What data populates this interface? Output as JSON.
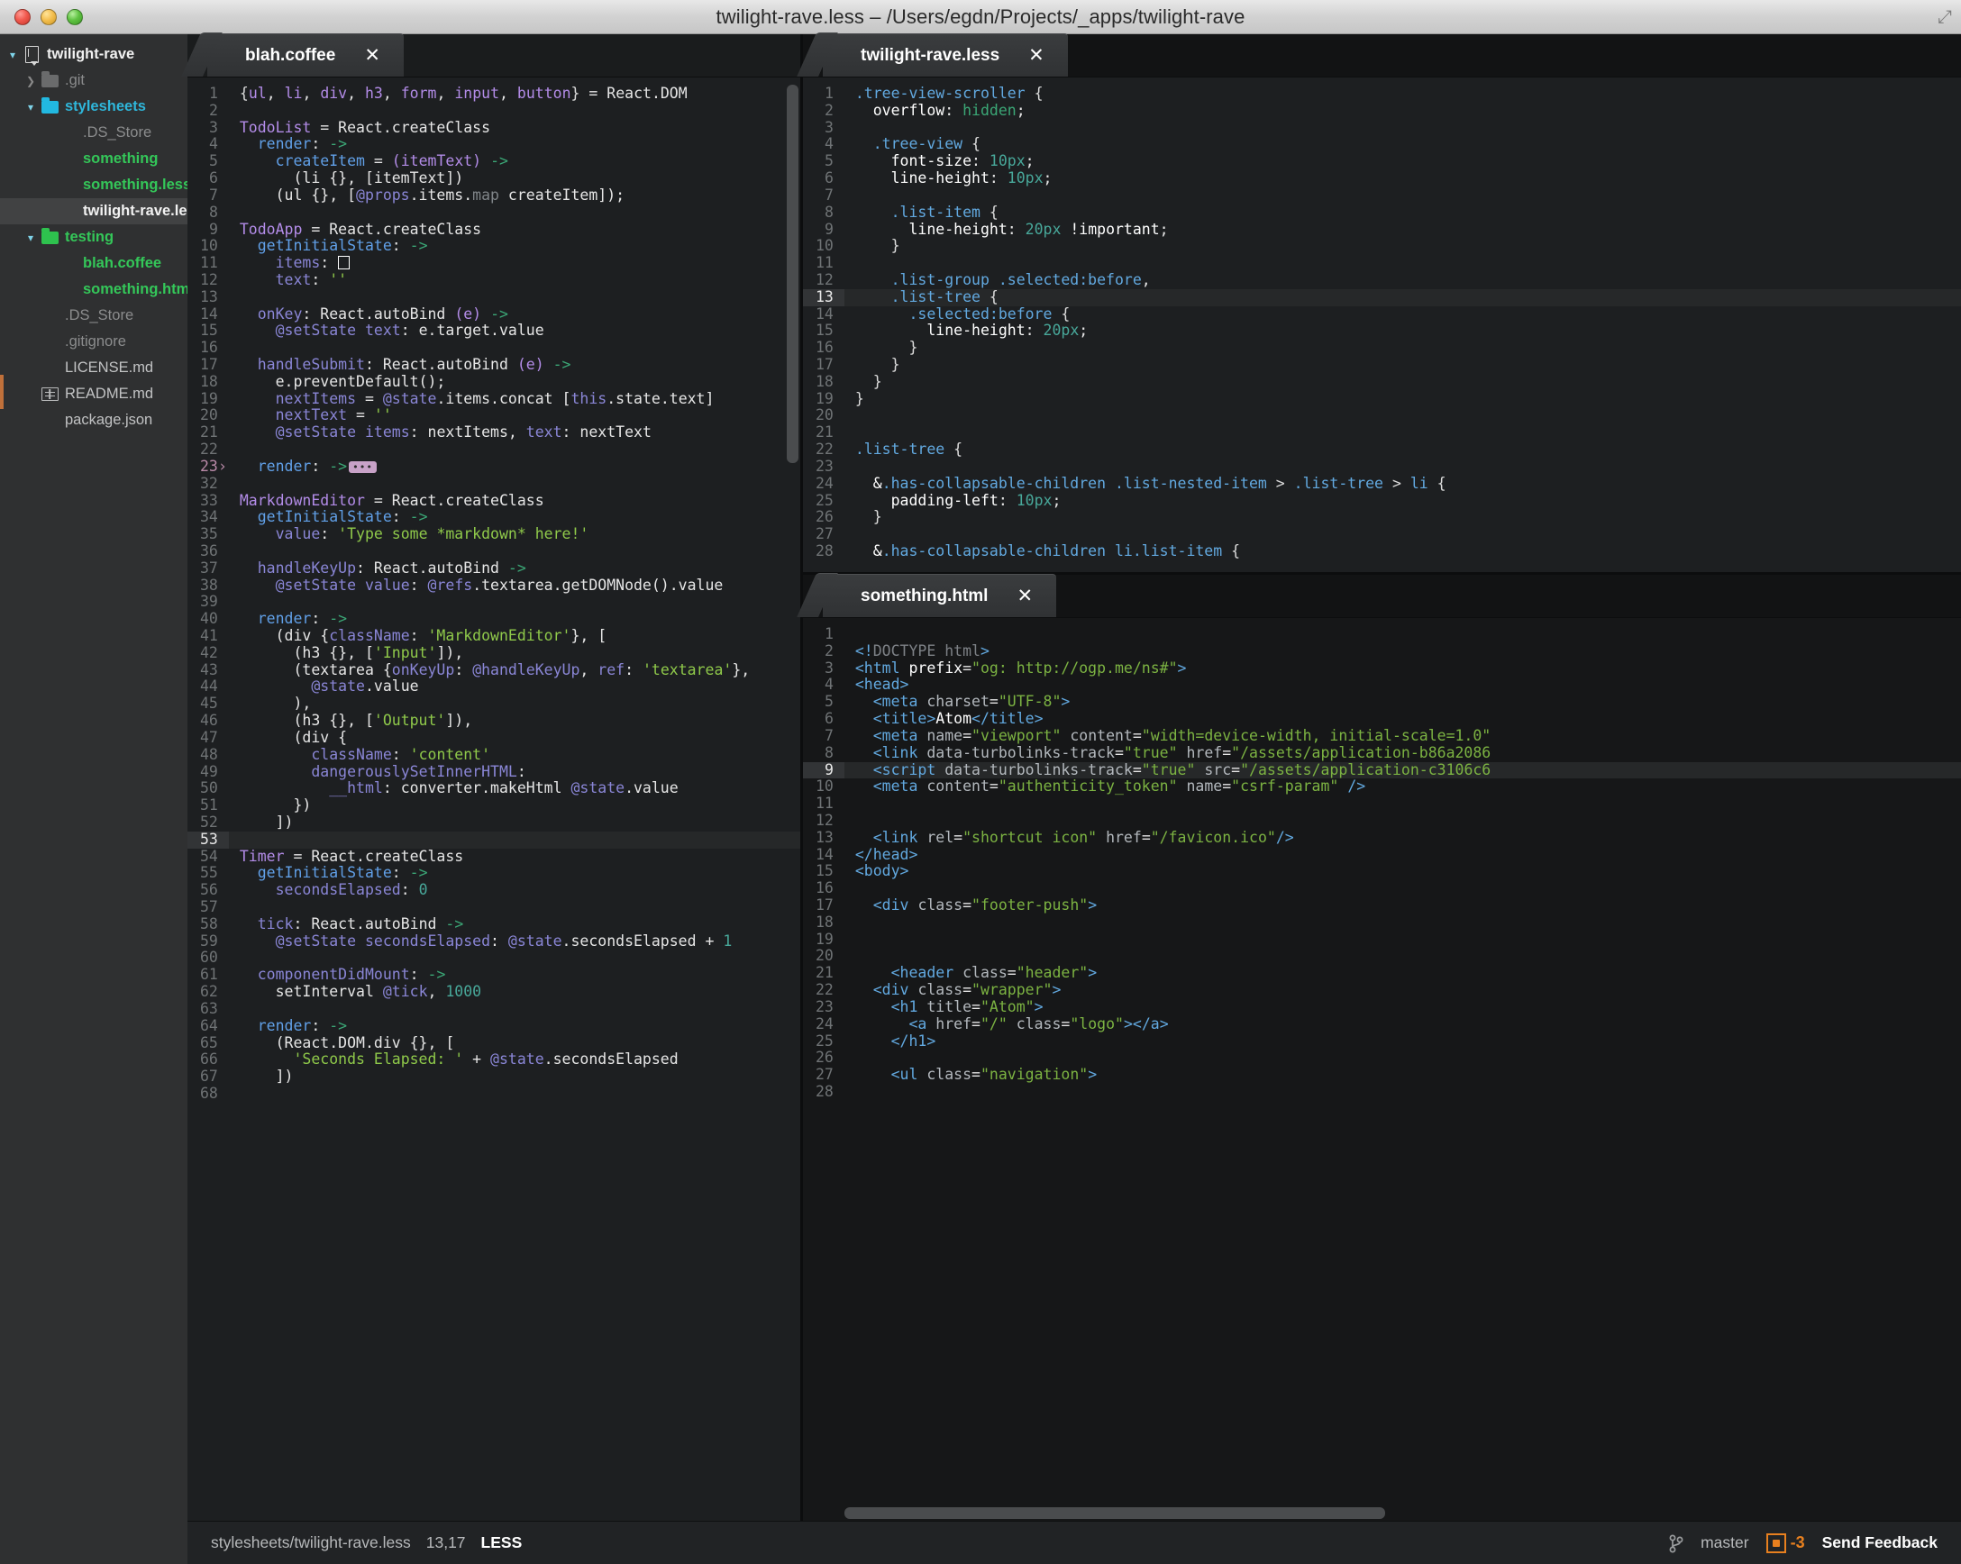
{
  "window": {
    "title": "twilight-rave.less – /Users/egdn/Projects/_apps/twilight-rave",
    "traffic_lights": [
      "close-button",
      "minimize-button",
      "zoom-button"
    ],
    "resize_grip": "⤢"
  },
  "sidebar": {
    "items": [
      {
        "label": "twilight-rave",
        "indent": 0,
        "twisty": "open",
        "icon": "repo-icon",
        "style": "white"
      },
      {
        "label": ".git",
        "indent": 1,
        "twisty": "closed",
        "icon": "folder-grey",
        "style": "dim"
      },
      {
        "label": "stylesheets",
        "indent": 1,
        "twisty": "open",
        "icon": "folder-cyan",
        "style": "cyan"
      },
      {
        "label": ".DS_Store",
        "indent": 2,
        "twisty": "none",
        "icon": "none",
        "style": "dim"
      },
      {
        "label": "something",
        "indent": 2,
        "twisty": "none",
        "icon": "none",
        "style": "green"
      },
      {
        "label": "something.less",
        "indent": 2,
        "twisty": "none",
        "icon": "none",
        "style": "green"
      },
      {
        "label": "twilight-rave.less",
        "indent": 2,
        "twisty": "none",
        "icon": "none",
        "style": "white",
        "selected": true
      },
      {
        "label": "testing",
        "indent": 1,
        "twisty": "open",
        "icon": "folder-green",
        "style": "green"
      },
      {
        "label": "blah.coffee",
        "indent": 2,
        "twisty": "none",
        "icon": "none",
        "style": "green"
      },
      {
        "label": "something.html",
        "indent": 2,
        "twisty": "none",
        "icon": "none",
        "style": "green"
      },
      {
        "label": ".DS_Store",
        "indent": 1,
        "twisty": "none",
        "icon": "none",
        "style": "dim"
      },
      {
        "label": ".gitignore",
        "indent": 1,
        "twisty": "none",
        "icon": "none",
        "style": "dim"
      },
      {
        "label": "LICENSE.md",
        "indent": 1,
        "twisty": "none",
        "icon": "none",
        "style": "mid"
      },
      {
        "label": "README.md",
        "indent": 1,
        "twisty": "none",
        "icon": "book-icon",
        "style": "mid"
      },
      {
        "label": "package.json",
        "indent": 1,
        "twisty": "none",
        "icon": "none",
        "style": "mid"
      }
    ]
  },
  "panes": {
    "left": {
      "tab": {
        "label": "blah.coffee",
        "close": "✕"
      },
      "first_line": 1,
      "lines": [
        {
          "n": "1",
          "html": "<span class='t-brace'>{</span><span class='t-def'>ul</span><span class='t-punct'>, </span><span class='t-def'>li</span><span class='t-punct'>, </span><span class='t-def'>div</span><span class='t-punct'>, </span><span class='t-def'>h3</span><span class='t-punct'>, </span><span class='t-def'>form</span><span class='t-punct'>, </span><span class='t-def'>input</span><span class='t-punct'>, </span><span class='t-def'>button</span><span class='t-brace'>}</span> = React.DOM"
        },
        {
          "n": "2",
          "html": ""
        },
        {
          "n": "3",
          "html": "<span class='t-def'>TodoList</span> = React.createClass"
        },
        {
          "n": "4",
          "html": "  <span class='t-fn'>render</span><span class='t-punct'>:</span> <span class='t-arrow'>-&gt;</span>"
        },
        {
          "n": "5",
          "html": "    <span class='t-fn'>createItem</span> = <span class='t-def'>(itemText)</span> <span class='t-arrow'>-&gt;</span>"
        },
        {
          "n": "6",
          "html": "      (li {}, [itemText])"
        },
        {
          "n": "7",
          "html": "    (ul {}, [<span class='t-prop'>@props</span>.items.<span class='t-grey'>map</span> createItem]);"
        },
        {
          "n": "8",
          "html": ""
        },
        {
          "n": "9",
          "html": "<span class='t-def'>TodoApp</span> = React.createClass"
        },
        {
          "n": "10",
          "html": "  <span class='t-fn'>getInitialState</span><span class='t-punct'>:</span> <span class='t-arrow'>-&gt;</span>"
        },
        {
          "n": "11",
          "html": "    <span class='t-prop'>items</span><span class='t-punct'>:</span> <span class='empty-sq-ph'></span>"
        },
        {
          "n": "12",
          "html": "    <span class='t-prop'>text</span><span class='t-punct'>:</span> <span class='t-str'>''</span>"
        },
        {
          "n": "13",
          "html": ""
        },
        {
          "n": "14",
          "html": "  <span class='t-prop'>onKey</span><span class='t-punct'>:</span> React.autoBind <span class='t-def'>(e)</span> <span class='t-arrow'>-&gt;</span>"
        },
        {
          "n": "15",
          "html": "    <span class='t-prop'>@setState text</span><span class='t-punct'>:</span> e.target.value"
        },
        {
          "n": "16",
          "html": ""
        },
        {
          "n": "17",
          "html": "  <span class='t-prop'>handleSubmit</span><span class='t-punct'>:</span> React.autoBind <span class='t-def'>(e)</span> <span class='t-arrow'>-&gt;</span>"
        },
        {
          "n": "18",
          "html": "    e.preventDefault();"
        },
        {
          "n": "19",
          "html": "    <span class='t-prop'>nextItems</span> = <span class='t-prop'>@state</span>.items.concat [<span class='t-prop'>this</span>.state.text]"
        },
        {
          "n": "20",
          "html": "    <span class='t-prop'>nextText</span> = <span class='t-str'>''</span>"
        },
        {
          "n": "21",
          "html": "    <span class='t-prop'>@setState items</span><span class='t-punct'>:</span> nextItems<span class='t-punct'>,</span> <span class='t-prop'>text</span><span class='t-punct'>:</span> nextText"
        },
        {
          "n": "22",
          "html": ""
        },
        {
          "n": "23",
          "html": "  <span class='t-fn'>render</span><span class='t-punct'>:</span> <span class='t-arrow'>-&gt;</span><span class='fold-ph'></span>",
          "fold": true
        },
        {
          "n": "32",
          "html": ""
        },
        {
          "n": "33",
          "html": "<span class='t-def'>MarkdownEditor</span> = React.createClass"
        },
        {
          "n": "34",
          "html": "  <span class='t-fn'>getInitialState</span><span class='t-punct'>:</span> <span class='t-arrow'>-&gt;</span>"
        },
        {
          "n": "35",
          "html": "    <span class='t-prop'>value</span><span class='t-punct'>:</span> <span class='t-str'>'Type some *markdown* here!'</span>"
        },
        {
          "n": "36",
          "html": ""
        },
        {
          "n": "37",
          "html": "  <span class='t-prop'>handleKeyUp</span><span class='t-punct'>:</span> React.autoBind <span class='t-arrow'>-&gt;</span>"
        },
        {
          "n": "38",
          "html": "    <span class='t-prop'>@setState value</span><span class='t-punct'>:</span> <span class='t-prop'>@refs</span>.textarea.getDOMNode().value"
        },
        {
          "n": "39",
          "html": ""
        },
        {
          "n": "40",
          "html": "  <span class='t-fn'>render</span><span class='t-punct'>:</span> <span class='t-arrow'>-&gt;</span>"
        },
        {
          "n": "41",
          "html": "    (div {<span class='t-prop'>className</span>: <span class='t-str'>'MarkdownEditor'</span>}, ["
        },
        {
          "n": "42",
          "html": "      (h3 {}, [<span class='t-str'>'Input'</span>]),"
        },
        {
          "n": "43",
          "html": "      (textarea {<span class='t-prop'>onKeyUp</span>: <span class='t-prop'>@handleKeyUp</span>, <span class='t-prop'>ref</span>: <span class='t-str'>'textarea'</span>},"
        },
        {
          "n": "44",
          "html": "        <span class='t-prop'>@state</span>.value"
        },
        {
          "n": "45",
          "html": "      ),"
        },
        {
          "n": "46",
          "html": "      (h3 {}, [<span class='t-str'>'Output'</span>]),"
        },
        {
          "n": "47",
          "html": "      (div {"
        },
        {
          "n": "48",
          "html": "        <span class='t-prop'>className</span>: <span class='t-str'>'content'</span>"
        },
        {
          "n": "49",
          "html": "        <span class='t-prop'>dangerouslySetInnerHTML</span>:"
        },
        {
          "n": "50",
          "html": "          <span class='t-prop'>__html</span>: converter.makeHtml <span class='t-prop'>@state</span>.value"
        },
        {
          "n": "51",
          "html": "      })"
        },
        {
          "n": "52",
          "html": "    ])"
        },
        {
          "n": "53",
          "html": "",
          "cursor": true
        },
        {
          "n": "54",
          "html": "<span class='t-def'>Timer</span> = React.createClass"
        },
        {
          "n": "55",
          "html": "  <span class='t-fn'>getInitialState</span><span class='t-punct'>:</span> <span class='t-arrow'>-&gt;</span>"
        },
        {
          "n": "56",
          "html": "    <span class='t-prop'>secondsElapsed</span><span class='t-punct'>:</span> <span class='t-num'>0</span>"
        },
        {
          "n": "57",
          "html": ""
        },
        {
          "n": "58",
          "html": "  <span class='t-prop'>tick</span><span class='t-punct'>:</span> React.autoBind <span class='t-arrow'>-&gt;</span>"
        },
        {
          "n": "59",
          "html": "    <span class='t-prop'>@setState secondsElapsed</span><span class='t-punct'>:</span> <span class='t-prop'>@state</span>.secondsElapsed + <span class='t-num'>1</span>"
        },
        {
          "n": "60",
          "html": ""
        },
        {
          "n": "61",
          "html": "  <span class='t-prop'>componentDidMount</span><span class='t-punct'>:</span> <span class='t-arrow'>-&gt;</span>"
        },
        {
          "n": "62",
          "html": "    setInterval <span class='t-prop'>@tick</span>, <span class='t-num'>1000</span>"
        },
        {
          "n": "63",
          "html": ""
        },
        {
          "n": "64",
          "html": "  <span class='t-fn'>render</span><span class='t-punct'>:</span> <span class='t-arrow'>-&gt;</span>"
        },
        {
          "n": "65",
          "html": "    (React.DOM.div {}, ["
        },
        {
          "n": "66",
          "html": "      <span class='t-str'>'Seconds Elapsed: '</span> + <span class='t-prop'>@state</span>.secondsElapsed"
        },
        {
          "n": "67",
          "html": "    ])"
        },
        {
          "n": "68",
          "html": ""
        }
      ]
    },
    "right_top": {
      "tab": {
        "label": "twilight-rave.less",
        "close": "✕"
      },
      "lines": [
        {
          "n": "1",
          "html": "<span class='t-sel'>.tree-view-scroller</span> <span class='t-brace'>{</span>"
        },
        {
          "n": "2",
          "html": "  <span class='t-plain'>overflow</span><span class='t-punct'>:</span> <span class='t-val'>hidden</span>;"
        },
        {
          "n": "3",
          "html": ""
        },
        {
          "n": "4",
          "html": "  <span class='t-sel'>.tree-view</span> <span class='t-brace'>{</span>"
        },
        {
          "n": "5",
          "html": "    <span class='t-plain'>font-size</span><span class='t-punct'>:</span> <span class='t-num'>10px</span>;"
        },
        {
          "n": "6",
          "html": "    <span class='t-plain'>line-height</span><span class='t-punct'>:</span> <span class='t-num'>10px</span>;"
        },
        {
          "n": "7",
          "html": ""
        },
        {
          "n": "8",
          "html": "    <span class='t-sel'>.list-item</span> <span class='t-brace'>{</span>"
        },
        {
          "n": "9",
          "html": "      <span class='t-plain'>line-height</span><span class='t-punct'>:</span> <span class='t-num'>20px</span> <span class='t-plain'>!important</span>;"
        },
        {
          "n": "10",
          "html": "    <span class='t-brace'>}</span>"
        },
        {
          "n": "11",
          "html": ""
        },
        {
          "n": "12",
          "html": "    <span class='t-sel'>.list-group .selected:before</span>,"
        },
        {
          "n": "13",
          "html": "    <span class='t-sel'>.list-tree</span> <span class='t-brace'>{</span>",
          "cursor": true
        },
        {
          "n": "14",
          "html": "      <span class='t-sel'>.selected:before</span> <span class='t-brace'>{</span>"
        },
        {
          "n": "15",
          "html": "        <span class='t-plain'>line-height</span><span class='t-punct'>:</span> <span class='t-num'>20px</span>;"
        },
        {
          "n": "16",
          "html": "      <span class='t-brace'>}</span>"
        },
        {
          "n": "17",
          "html": "    <span class='t-brace'>}</span>"
        },
        {
          "n": "18",
          "html": "  <span class='t-brace'>}</span>"
        },
        {
          "n": "19",
          "html": "<span class='t-brace'>}</span>"
        },
        {
          "n": "20",
          "html": ""
        },
        {
          "n": "21",
          "html": ""
        },
        {
          "n": "22",
          "html": "<span class='t-sel'>.list-tree</span> <span class='t-brace'>{</span>"
        },
        {
          "n": "23",
          "html": ""
        },
        {
          "n": "24",
          "html": "  <span class='t-amp'>&amp;</span><span class='t-sel'>.has-collapsable-children .list-nested-item</span> <span class='t-brace'>&gt;</span> <span class='t-sel'>.list-tree</span> <span class='t-brace'>&gt;</span> <span class='t-sel'>li</span> <span class='t-brace'>{</span>"
        },
        {
          "n": "25",
          "html": "    <span class='t-plain'>padding-left</span><span class='t-punct'>:</span> <span class='t-num'>10px</span>;"
        },
        {
          "n": "26",
          "html": "  <span class='t-brace'>}</span>"
        },
        {
          "n": "27",
          "html": ""
        },
        {
          "n": "28",
          "html": "  <span class='t-amp'>&amp;</span><span class='t-sel'>.has-collapsable-children li.list-item</span> <span class='t-brace'>{</span>"
        }
      ]
    },
    "right_bottom": {
      "tab": {
        "label": "something.html",
        "close": "✕"
      },
      "lines": [
        {
          "n": "1",
          "html": ""
        },
        {
          "n": "2",
          "html": "<span class='t-tag'>&lt;!</span><span class='t-doc'>DOCTYPE html</span><span class='t-tag'>&gt;</span>"
        },
        {
          "n": "3",
          "html": "<span class='t-tag'>&lt;html</span> <span class='t-white'>prefix</span>=<span class='t-atval'>\"og: http://ogp.me/ns#\"</span><span class='t-tag'>&gt;</span>"
        },
        {
          "n": "4",
          "html": "<span class='t-tag'>&lt;head&gt;</span>"
        },
        {
          "n": "5",
          "html": "  <span class='t-tag'>&lt;meta</span> <span class='t-attr'>charset</span>=<span class='t-atval'>\"UTF-8\"</span><span class='t-tag'>&gt;</span>"
        },
        {
          "n": "6",
          "html": "  <span class='t-tag'>&lt;title&gt;</span><span class='t-white'>Atom</span><span class='t-tag'>&lt;/title&gt;</span>"
        },
        {
          "n": "7",
          "html": "  <span class='t-tag'>&lt;meta</span> <span class='t-attr'>name</span>=<span class='t-atval'>\"viewport\"</span> <span class='t-attr'>content</span>=<span class='t-atval'>\"width=device-width, initial-scale=1.0\"</span>"
        },
        {
          "n": "8",
          "html": "  <span class='t-tag'>&lt;link</span> <span class='t-attr'>data-turbolinks-track</span>=<span class='t-atval'>\"true\"</span> <span class='t-attr'>href</span>=<span class='t-atval'>\"/assets/application-b86a2086</span>"
        },
        {
          "n": "9",
          "html": "  <span class='t-tag'>&lt;script</span> <span class='t-attr'>data-turbolinks-track</span>=<span class='t-atval'>\"true\"</span> <span class='t-attr'>src</span>=<span class='t-atval'>\"/assets/application-c3106c6</span>",
          "cursor": true
        },
        {
          "n": "10",
          "html": "  <span class='t-tag'>&lt;meta</span> <span class='t-attr'>content</span>=<span class='t-atval'>\"authenticity_token\"</span> <span class='t-attr'>name</span>=<span class='t-atval'>\"csrf-param\"</span> <span class='t-tag'>/&gt;</span>"
        },
        {
          "n": "11",
          "html": ""
        },
        {
          "n": "12",
          "html": ""
        },
        {
          "n": "13",
          "html": "  <span class='t-tag'>&lt;link</span> <span class='t-attr'>rel</span>=<span class='t-atval'>\"shortcut icon\"</span> <span class='t-attr'>href</span>=<span class='t-atval'>\"/favicon.ico\"</span><span class='t-tag'>/&gt;</span>"
        },
        {
          "n": "14",
          "html": "<span class='t-tag'>&lt;/head&gt;</span>"
        },
        {
          "n": "15",
          "html": "<span class='t-tag'>&lt;body&gt;</span>"
        },
        {
          "n": "16",
          "html": ""
        },
        {
          "n": "17",
          "html": "  <span class='t-tag'>&lt;div</span> <span class='t-attr'>class</span>=<span class='t-atval'>\"footer-push\"</span><span class='t-tag'>&gt;</span>"
        },
        {
          "n": "18",
          "html": ""
        },
        {
          "n": "19",
          "html": ""
        },
        {
          "n": "20",
          "html": ""
        },
        {
          "n": "21",
          "html": "    <span class='t-tag'>&lt;header</span> <span class='t-attr'>class</span>=<span class='t-atval'>\"header\"</span><span class='t-tag'>&gt;</span>"
        },
        {
          "n": "22",
          "html": "  <span class='t-tag'>&lt;div</span> <span class='t-attr'>class</span>=<span class='t-atval'>\"wrapper\"</span><span class='t-tag'>&gt;</span>"
        },
        {
          "n": "23",
          "html": "    <span class='t-tag'>&lt;h1</span> <span class='t-attr'>title</span>=<span class='t-atval'>\"Atom\"</span><span class='t-tag'>&gt;</span>"
        },
        {
          "n": "24",
          "html": "      <span class='t-tag'>&lt;a</span> <span class='t-attr'>href</span>=<span class='t-atval'>\"/\"</span> <span class='t-attr'>class</span>=<span class='t-atval'>\"logo\"</span><span class='t-tag'>&gt;&lt;/a&gt;</span>"
        },
        {
          "n": "25",
          "html": "    <span class='t-tag'>&lt;/h1&gt;</span>"
        },
        {
          "n": "26",
          "html": ""
        },
        {
          "n": "27",
          "html": "    <span class='t-tag'>&lt;ul</span> <span class='t-attr'>class</span>=<span class='t-atval'>\"navigation\"</span><span class='t-tag'>&gt;</span>"
        },
        {
          "n": "28",
          "html": ""
        }
      ]
    }
  },
  "statusbar": {
    "path": "stylesheets/twilight-rave.less",
    "cursor_position": "13,17",
    "grammar": "LESS",
    "branch": "master",
    "diagnostics_count": "-3",
    "feedback_label": "Send Feedback"
  }
}
